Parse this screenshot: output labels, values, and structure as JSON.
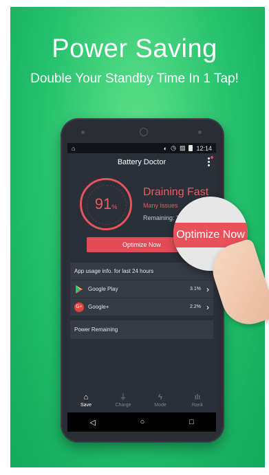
{
  "promo": {
    "title": "Power Saving",
    "subtitle": "Double Your Standby Time In 1 Tap!"
  },
  "status_bar": {
    "left_icon": "notification-icon",
    "time": "12:14"
  },
  "app": {
    "title": "Battery Doctor"
  },
  "gauge": {
    "value": "91",
    "unit": "%",
    "title": "Draining Fast",
    "subtitle": "Many Issues",
    "remaining": "Remaining: 20"
  },
  "optimize_button": "Optimize Now",
  "magnifier_label": "Optimize Now",
  "usage": {
    "header": "App usage info. for last 24 hours",
    "rows": [
      {
        "name": "Google Play",
        "percent": "3.1%",
        "icon": "google-play-icon"
      },
      {
        "name": "Google+",
        "percent": "2.2%",
        "icon": "google-plus-icon"
      }
    ],
    "power_remaining": "Power Remaining"
  },
  "nav": [
    {
      "label": "Save",
      "icon": "home-icon"
    },
    {
      "label": "Charge",
      "icon": "plug-icon"
    },
    {
      "label": "Mode",
      "icon": "bolt-icon"
    },
    {
      "label": "Rank",
      "icon": "bar-chart-icon"
    }
  ],
  "colors": {
    "accent": "#e24b55",
    "background_green": "#22c06c"
  }
}
